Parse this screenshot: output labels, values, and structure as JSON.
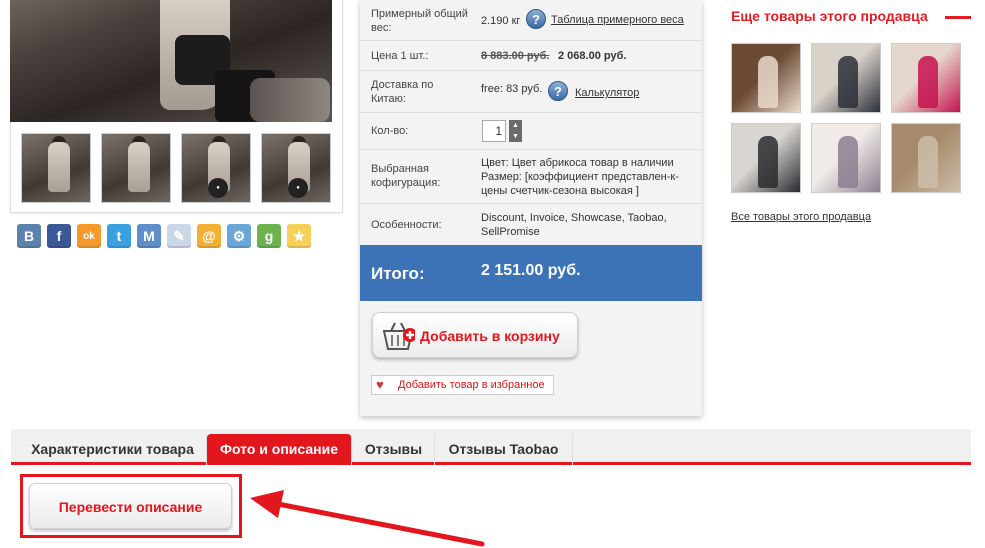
{
  "social_icons": [
    {
      "name": "vk-icon",
      "glyph": "B",
      "color": "#5b82ad"
    },
    {
      "name": "facebook-icon",
      "glyph": "f",
      "color": "#3b5998"
    },
    {
      "name": "odnoklassniki-icon",
      "glyph": "ok",
      "color": "#f59a2a"
    },
    {
      "name": "twitter-icon",
      "glyph": "t",
      "color": "#3aa1e0"
    },
    {
      "name": "moimir-icon",
      "glyph": "M",
      "color": "#5f8fc8"
    },
    {
      "name": "livejournal-icon",
      "glyph": "✎",
      "color": "#c9d7e6"
    },
    {
      "name": "mail-icon",
      "glyph": "@",
      "color": "#f2b133"
    },
    {
      "name": "settings-icon",
      "glyph": "⚙",
      "color": "#6aa6d8"
    },
    {
      "name": "google-icon",
      "glyph": "g",
      "color": "#6db24f"
    },
    {
      "name": "favorite-star-icon",
      "glyph": "★",
      "color": "#f7d05a"
    }
  ],
  "product": {
    "weight_label": "Примерный общий вес:",
    "weight_value": "2.190 кг",
    "weight_table_link": "Таблица примерного веса",
    "price_label": "Цена 1 шт.:",
    "price_old": "8 883.00 руб.",
    "price_new": "2 068.00 руб.",
    "delivery_label": "Доставка по Китаю:",
    "delivery_value": "free: 83 руб.",
    "calculator_link": "Калькулятор",
    "qty_label": "Кол-во:",
    "qty_value": "1",
    "config_label": "Выбранная кофигурация:",
    "config_value": "Цвет: Цвет абрикоса товар в наличии Размер: [коэффициент представлен-к-цены счетчик-сезона высокая ]",
    "features_label": "Особенности:",
    "features_value": "Discount, Invoice, Showcase, Taobao, SellPromise",
    "total_label": "Итого:",
    "total_value": "2 151.00 руб.",
    "add_to_cart": "Добавить в корзину",
    "add_to_favorites": "Добавить товар в избранное",
    "help_glyph": "?"
  },
  "seller": {
    "title": "Еще товары этого продавца",
    "all_link": "Все товары этого продавца",
    "thumb_colors": [
      [
        "#6b4a35",
        "#e9d9c8"
      ],
      [
        "#d9d2c8",
        "#2b2f3a"
      ],
      [
        "#e6d7cc",
        "#c4134f"
      ],
      [
        "#d9d6d2",
        "#2a2a2f"
      ],
      [
        "#f0ebe6",
        "#8a7f92"
      ],
      [
        "#a78a6c",
        "#cdbda9"
      ]
    ]
  },
  "tabs": [
    "Характеристики товара",
    "Фото и описание",
    "Отзывы",
    "Отзывы Taobao"
  ],
  "translate_button": "Перевести описание",
  "accent_color": "#e2161c"
}
